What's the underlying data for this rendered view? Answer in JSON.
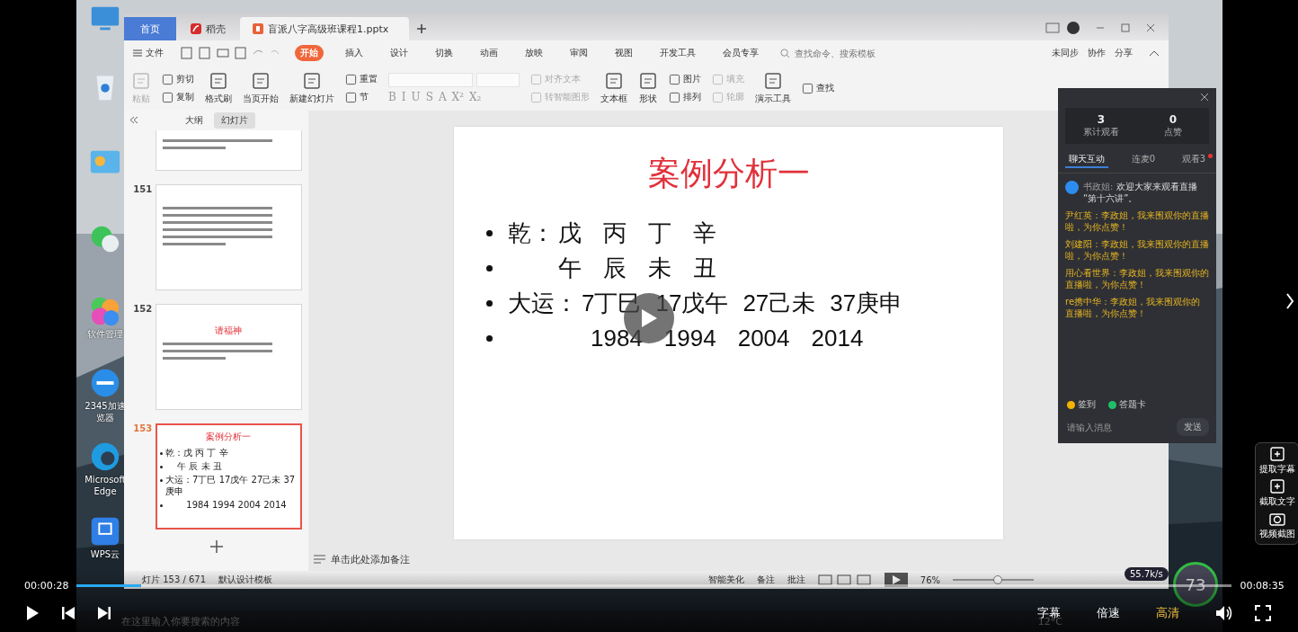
{
  "desktop": {
    "icons": [
      {
        "kind": "computer"
      },
      {
        "kind": "bin"
      },
      {
        "kind": "panel"
      },
      {
        "kind": "chat"
      },
      {
        "kind": "petals",
        "lines": [
          "软件管理"
        ]
      },
      {
        "kind": "browser",
        "lines": [
          "2345加速",
          "览器"
        ]
      },
      {
        "kind": "edge",
        "lines": [
          "Microsoft",
          "Edge"
        ]
      },
      {
        "kind": "cloud",
        "lines": [
          "WPS云"
        ]
      }
    ],
    "taskbar": {
      "search_placeholder": "在这里输入你要搜索的内容",
      "weather": "12°C"
    }
  },
  "wps": {
    "tabs": [
      {
        "label": "首页",
        "kind": "home",
        "selected": false
      },
      {
        "label": "稻壳",
        "kind": "docer",
        "selected": false
      },
      {
        "label": "盲派八字高级班课程1.pptx",
        "kind": "file",
        "selected": true
      }
    ],
    "file_menu": "文件",
    "ribbon_tabs": [
      {
        "label": "开始",
        "selected": true
      },
      {
        "label": "插入",
        "selected": false
      },
      {
        "label": "设计",
        "selected": false
      },
      {
        "label": "切换",
        "selected": false
      },
      {
        "label": "动画",
        "selected": false
      },
      {
        "label": "放映",
        "selected": false
      },
      {
        "label": "审阅",
        "selected": false
      },
      {
        "label": "视图",
        "selected": false
      },
      {
        "label": "开发工具",
        "selected": false
      },
      {
        "label": "会员专享",
        "selected": false
      }
    ],
    "command_search": {
      "placeholder": "查找命令、搜索模板"
    },
    "right_actions": [
      "未同步",
      "协作",
      "分享"
    ],
    "toolbar": [
      {
        "kind": "large",
        "label": "粘贴",
        "disabled": true
      },
      {
        "kind": "pair",
        "items": [
          {
            "label": "剪切",
            "disabled": false
          },
          {
            "label": "复制",
            "disabled": false
          }
        ]
      },
      {
        "kind": "large",
        "label": "格式刷",
        "disabled": false
      },
      {
        "kind": "large",
        "label": "当页开始",
        "disabled": false
      },
      {
        "kind": "large",
        "label": "新建幻灯片",
        "disabled": false
      },
      {
        "kind": "pair",
        "items": [
          {
            "label": "重置",
            "disabled": false
          },
          {
            "label": "节",
            "disabled": false
          }
        ]
      },
      {
        "kind": "format",
        "items": [
          "B",
          "I",
          "U",
          "S",
          "A",
          "X²",
          "X₂"
        ]
      },
      {
        "kind": "pair",
        "items": [
          {
            "label": "对齐文本",
            "disabled": true
          },
          {
            "label": "转智能图形",
            "disabled": true
          }
        ]
      },
      {
        "kind": "large",
        "label": "文本框",
        "disabled": false
      },
      {
        "kind": "large",
        "label": "形状",
        "disabled": false
      },
      {
        "kind": "pair",
        "items": [
          {
            "label": "图片",
            "disabled": false
          },
          {
            "label": "排列",
            "disabled": false
          }
        ]
      },
      {
        "kind": "pair",
        "items": [
          {
            "label": "填充",
            "disabled": true
          },
          {
            "label": "轮廓",
            "disabled": true
          }
        ]
      },
      {
        "kind": "large",
        "label": "演示工具",
        "disabled": false
      },
      {
        "kind": "pair",
        "items": [
          {
            "label": "查找",
            "disabled": false
          }
        ]
      }
    ],
    "panel_tabs": [
      {
        "label": "大纲",
        "selected": false
      },
      {
        "label": "幻灯片",
        "selected": true
      }
    ],
    "thumbnails": [
      {
        "kind": "lines",
        "selected": false
      },
      {
        "kind": "lines",
        "number": "151",
        "selected": false
      },
      {
        "kind": "titled",
        "number": "152",
        "title": "请福神",
        "selected": false
      },
      {
        "kind": "content",
        "number": "153",
        "title": "案例分析一",
        "selected": true,
        "rows": [
          "乾：戊 丙 丁 辛",
          "　 午 辰 未 丑",
          "大运：7丁巳 17戊午 27己未 37庚申",
          "　　 1984 1994 2004 2014"
        ]
      }
    ],
    "slide": {
      "title": "案例分析一",
      "bullets": [
        {
          "kind": "pillars",
          "lead": "乾：",
          "cells": [
            "戊",
            "丙",
            "丁",
            "辛"
          ]
        },
        {
          "kind": "pillars",
          "cells": [
            "午",
            "辰",
            "未",
            "丑"
          ]
        },
        {
          "kind": "luck",
          "lead": "大运：",
          "cells": [
            "7丁巳",
            "17戊午",
            "27己未",
            "37庚申"
          ]
        },
        {
          "kind": "years",
          "cells": [
            "1984",
            "1994",
            "2004",
            "2014"
          ]
        }
      ]
    },
    "notes_placeholder": "单击此处添加备注",
    "status": {
      "slide_count": "灯片 153 / 671",
      "template": "默认设计模板",
      "beautify": "智能美化",
      "notes": "备注",
      "comments": "批注",
      "zoom": "76%",
      "zoom_slider": {
        "level": 0.55
      }
    }
  },
  "live_panel": {
    "stats": [
      {
        "value": "3",
        "label": "累计观看"
      },
      {
        "value": "0",
        "label": "点赞"
      }
    ],
    "tabs": [
      {
        "label": "聊天互动",
        "selected": true,
        "dot": false
      },
      {
        "label": "连麦0",
        "selected": false,
        "dot": false
      },
      {
        "label": "观看3",
        "selected": false,
        "dot": true
      }
    ],
    "messages": [
      {
        "kind": "system",
        "user": "书政姐:",
        "text": "欢迎大家来观看直播 “第十六讲”。"
      },
      {
        "kind": "user",
        "user": "尹红英：",
        "text": "李政姐，我来围观你的直播啦，为你点赞！"
      },
      {
        "kind": "user",
        "user": "刘建阳：",
        "text": "李政姐，我来围观你的直播啦，为你点赞！"
      },
      {
        "kind": "user",
        "user": "用心看世界：",
        "text": "李政姐，我来围观你的直播啦，为你点赞！"
      },
      {
        "kind": "user",
        "user": "re携中华：",
        "text": "李政姐，我来围观你的直播啦，为你点赞！"
      }
    ],
    "actions": [
      {
        "label": "签到",
        "color": "#f5b301"
      },
      {
        "label": "答题卡",
        "color": "#1fbf6a"
      }
    ],
    "input": {
      "placeholder": "请输入消息"
    },
    "send": "发送"
  },
  "net_widget": {
    "speed": "55.7k/s",
    "percent": "73"
  },
  "player": {
    "current_time": "00:00:28",
    "total_time": "00:08:35",
    "progress": {
      "level": 0.056
    },
    "buttons": [
      {
        "label": "字幕",
        "selected": false
      },
      {
        "label": "倍速",
        "selected": false
      },
      {
        "label": "高清",
        "selected": true
      }
    ],
    "side_tools": [
      "提取字幕",
      "截取文字",
      "视频截图"
    ]
  }
}
